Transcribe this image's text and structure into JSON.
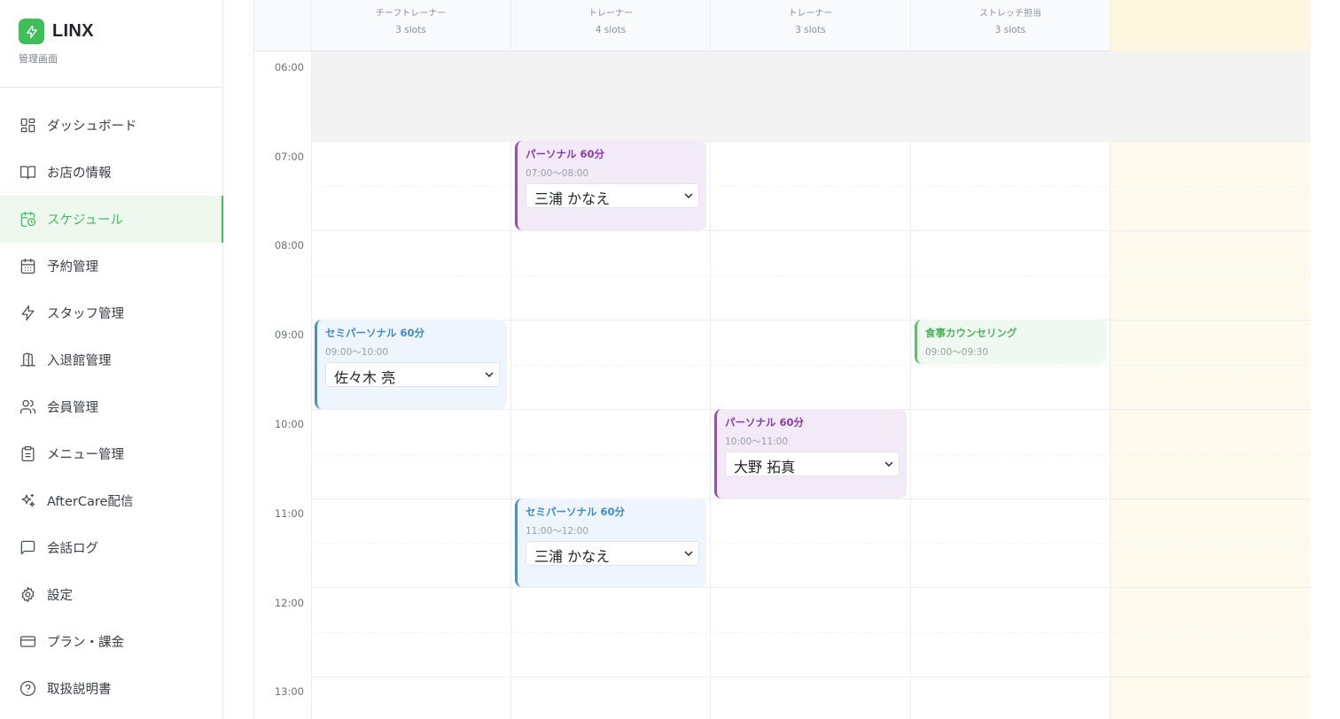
{
  "brand": {
    "name": "LINX",
    "subtitle": "管理画面",
    "color": "#3fbf5a",
    "icon": "bolt-icon"
  },
  "sidebar": {
    "items": [
      {
        "label": "ダッシュボード",
        "icon": "dashboard-icon",
        "active": false
      },
      {
        "label": "お店の情報",
        "icon": "book-icon",
        "active": false
      },
      {
        "label": "スケジュール",
        "icon": "calendar-clock-icon",
        "active": true
      },
      {
        "label": "予約管理",
        "icon": "calendar-icon",
        "active": false
      },
      {
        "label": "スタッフ管理",
        "icon": "bolt-icon",
        "active": false
      },
      {
        "label": "入退館管理",
        "icon": "door-icon",
        "active": false
      },
      {
        "label": "会員管理",
        "icon": "users-icon",
        "active": false
      },
      {
        "label": "メニュー管理",
        "icon": "clipboard-icon",
        "active": false
      },
      {
        "label": "AfterCare配信",
        "icon": "sparkles-icon",
        "active": false
      },
      {
        "label": "会話ログ",
        "icon": "chat-icon",
        "active": false
      },
      {
        "label": "設定",
        "icon": "gear-icon",
        "active": false
      },
      {
        "label": "プラン・課金",
        "icon": "credit-card-icon",
        "active": false
      },
      {
        "label": "取扱説明書",
        "icon": "help-circle-icon",
        "active": false
      }
    ]
  },
  "calendar": {
    "columns": [
      {
        "role": "チーフトレーナー",
        "slots": "3 slots"
      },
      {
        "role": "トレーナー",
        "slots": "4 slots"
      },
      {
        "role": "トレーナー",
        "slots": "3 slots"
      },
      {
        "role": "ストレッチ担当",
        "slots": "3 slots"
      },
      {
        "role": "",
        "slots": ""
      }
    ],
    "times": [
      "06:00",
      "07:00",
      "08:00",
      "09:00",
      "10:00",
      "11:00",
      "12:00",
      "13:00"
    ],
    "events": [
      {
        "column": 1,
        "title": "パーソナル 60分",
        "time": "07:00〜08:00",
        "staff": "三浦 かなえ",
        "color": "purple"
      },
      {
        "column": 0,
        "title": "セミパーソナル 60分",
        "time": "09:00〜10:00",
        "staff": "佐々木 亮",
        "color": "blue"
      },
      {
        "column": 3,
        "title": "食事カウンセリング",
        "time": "09:00〜09:30",
        "staff": "",
        "color": "green"
      },
      {
        "column": 2,
        "title": "パーソナル 60分",
        "time": "10:00〜11:00",
        "staff": "大野 拓真",
        "color": "purple"
      },
      {
        "column": 1,
        "title": "セミパーソナル 60分",
        "time": "11:00〜12:00",
        "staff": "三浦 かなえ",
        "color": "blue"
      }
    ]
  }
}
